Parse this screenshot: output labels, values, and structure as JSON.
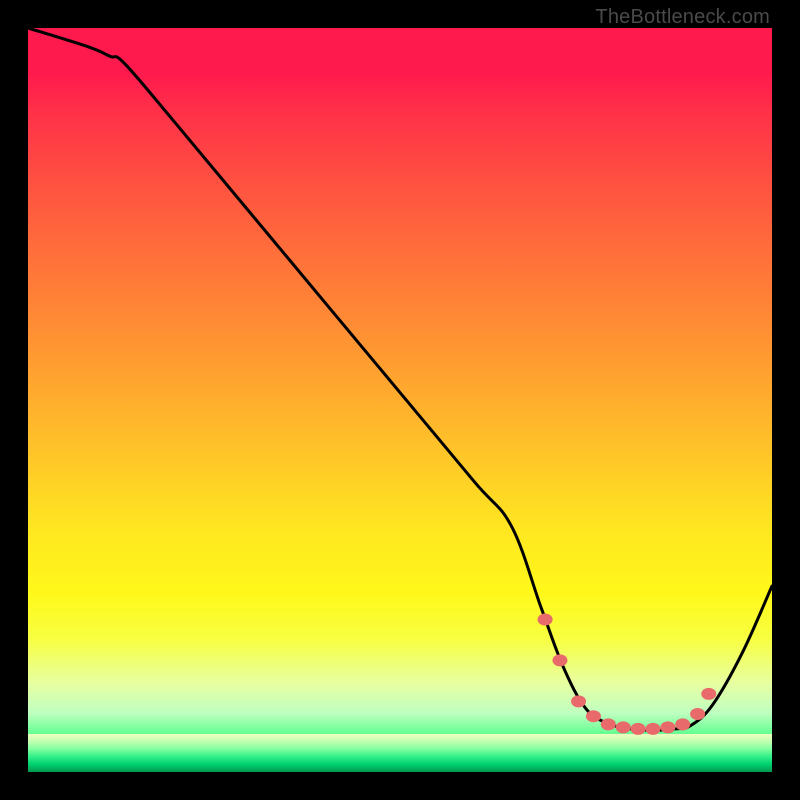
{
  "watermark": "TheBottleneck.com",
  "chart_data": {
    "type": "line",
    "title": "",
    "xlabel": "",
    "ylabel": "",
    "xlim": [
      0,
      100
    ],
    "ylim": [
      0,
      100
    ],
    "series": [
      {
        "name": "curve",
        "x": [
          0,
          8,
          11,
          13,
          20,
          30,
          40,
          50,
          60,
          65,
          69,
          72,
          75,
          78,
          81,
          84,
          87,
          89,
          92,
          96,
          100
        ],
        "y": [
          100,
          97.5,
          96.2,
          95.2,
          87,
          75,
          63,
          51,
          39,
          33,
          22,
          14,
          8.5,
          6.5,
          5.8,
          5.6,
          5.8,
          6.2,
          9,
          16,
          25
        ]
      }
    ],
    "markers": {
      "name": "highlight-dots",
      "x": [
        69.5,
        71.5,
        74,
        76,
        78,
        80,
        82,
        84,
        86,
        88,
        90,
        91.5
      ],
      "y": [
        20.5,
        15,
        9.5,
        7.5,
        6.4,
        6.0,
        5.8,
        5.8,
        6.0,
        6.4,
        7.8,
        10.5
      ]
    }
  },
  "colors": {
    "curve": "#000000",
    "dots": "#e86a6a"
  }
}
